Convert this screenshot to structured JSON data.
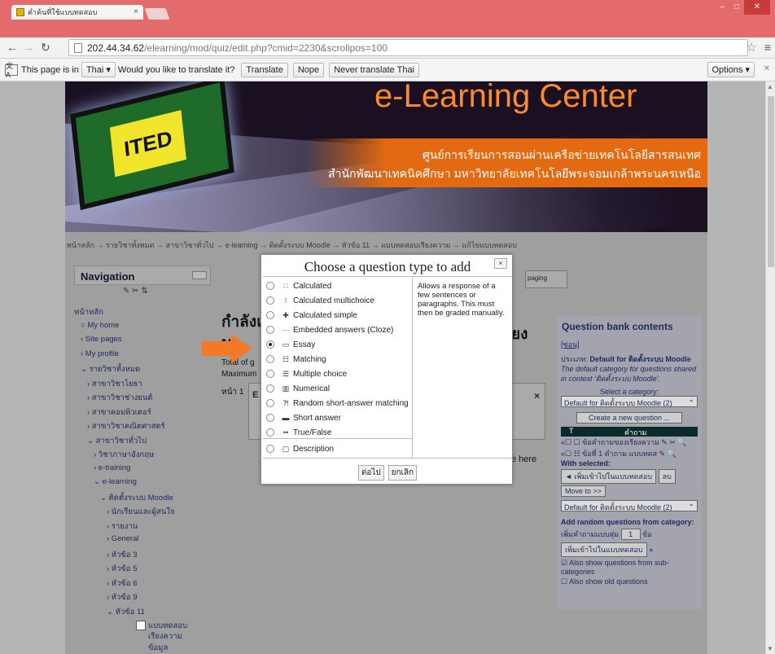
{
  "browser": {
    "tab_title": "คำค้นที่ใช้แบบทดสอบ",
    "url_host": "202.44.34.62",
    "url_path": "/elearning/mod/quiz/edit.php?cmid=2230&scrollpos=100",
    "translate_bar": {
      "text_1": "This page is in",
      "language": "Thai ▾",
      "text_2": "Would you like to translate it?",
      "translate": "Translate",
      "nope": "Nope",
      "never": "Never translate Thai",
      "options": "Options ▾"
    },
    "win_min": "–",
    "win_max": "□",
    "win_close": "✕"
  },
  "banner": {
    "title": "e-Learning Center",
    "logo": "ITED",
    "line1": "ศูนย์การเรียนการสอนผ่านเครือข่ายเทคโนโลยีสารสนเทศ",
    "line2": "สำนักพัฒนาเทคนิคศึกษา มหาวิทยาลัยเทคโนโลยีพระจอมเกล้าพระนครเหนือ"
  },
  "breadcrumb": "หน้าหลัก → รายวิชาทั้งหมด → สาขาวิชาทั่วไป → e-learning → ติดตั้งระบบ Moodle → หัวข้อ 11 → แบบทดสอบเรียงความ → แก้ไขแบบทดสอบ",
  "navigation": {
    "title": "Navigation",
    "items": [
      "หน้าหลัก",
      "○ My home",
      "› Site pages",
      "› My profile",
      "⌄ รายวิชาทั้งหมด",
      "› สาขาวิชาโยธา",
      "› สาขาวิชาช่างยนต์",
      "› สาขาคอมพิวเตอร์",
      "› สาขาวิชาคณิตศาสตร์",
      "⌄ สาขาวิชาทั่วไป",
      "› วิชาภาษาอังกฤษ",
      "› e-training",
      "⌄ e-learning",
      "⌄ ติดตั้งระบบ Moodle",
      "› นักเรียนและผู้สนใจ",
      "› รายงาน",
      "› General",
      "› หัวข้อ 3",
      "› หัวข้อ 5",
      "› หัวข้อ 6",
      "› หัวข้อ 9",
      "⌄ หัวข้อ 11",
      "แบบทดสอบ",
      "เรียงความ",
      "ข้อมูล"
    ]
  },
  "main": {
    "heading_1": "กำลังแ",
    "heading_1_end": "ยง",
    "heading_2": "ม",
    "total_grade": "Total of g",
    "maximum": "Maximum",
    "page_1": "หน้า 1",
    "paging": "paging",
    "e_here": "e here",
    "inner_e": "E"
  },
  "qbank": {
    "title": "Question bank contents",
    "hide": "[ซ่อน]",
    "category_label": "ประเภท:",
    "category_name": "Default for ติดตั้งระบบ Moodle",
    "category_desc": "The default category for questions shared in context 'ติดตั้งระบบ Moodle'.",
    "select_label": "Select a category:",
    "select_value": "Default for ติดตั้งระบบ Moodle (2)",
    "create_btn": "Create a new question ...",
    "col_t": "T",
    "col_q": "คำถาม",
    "row1": "«☐ ☐ ข้อคำถามของเรียงความ ✎ ✂ 🔍",
    "row2": "«☐ ☷ ข้อที่ 1 คำถาม แบบทดส ✎ 🔍",
    "with_selected": "With selected:",
    "add_to_quiz": "◄ เพิ่มเข้าไปในแบบทดสอบ",
    "delete": "ลบ",
    "move_to": "Move to >>",
    "move_value": "Default for ติดตั้งระบบ Moodle (2)",
    "add_random": "Add random questions from category:",
    "add_count_label": "เพิ่มคำถามแบบสุ่ม",
    "add_count": "1",
    "add_count_unit": "ข้อ",
    "add_btn": "เพิ่มเข้าไปในแบบทดสอบ",
    "sub_cats": "Also show questions from sub-categories",
    "old_q": "Also show old questions"
  },
  "dialog": {
    "title": "Choose a question type to add",
    "close": "×",
    "options": [
      {
        "icon": "∷",
        "label": "Calculated"
      },
      {
        "icon": "⁞",
        "label": "Calculated multichoice"
      },
      {
        "icon": "✚",
        "label": "Calculated simple"
      },
      {
        "icon": "⋯",
        "label": "Embedded answers (Cloze)"
      },
      {
        "icon": "▭",
        "label": "Essay"
      },
      {
        "icon": "☷",
        "label": "Matching"
      },
      {
        "icon": "☰",
        "label": "Multiple choice"
      },
      {
        "icon": "▥",
        "label": "Numerical"
      },
      {
        "icon": "⁈",
        "label": "Random short-answer matching"
      },
      {
        "icon": "▬",
        "label": "Short answer"
      },
      {
        "icon": "••",
        "label": "True/False"
      },
      {
        "icon": "▢",
        "label": "Description"
      }
    ],
    "selected": "Essay",
    "description": "Allows a response of a few sentences or paragraphs. This must then be graded manually.",
    "next": "ต่อไป",
    "cancel": "ยกเลิก"
  },
  "colors": {
    "arrow": "#f07a2a",
    "titlebar": "#e46b6b"
  }
}
